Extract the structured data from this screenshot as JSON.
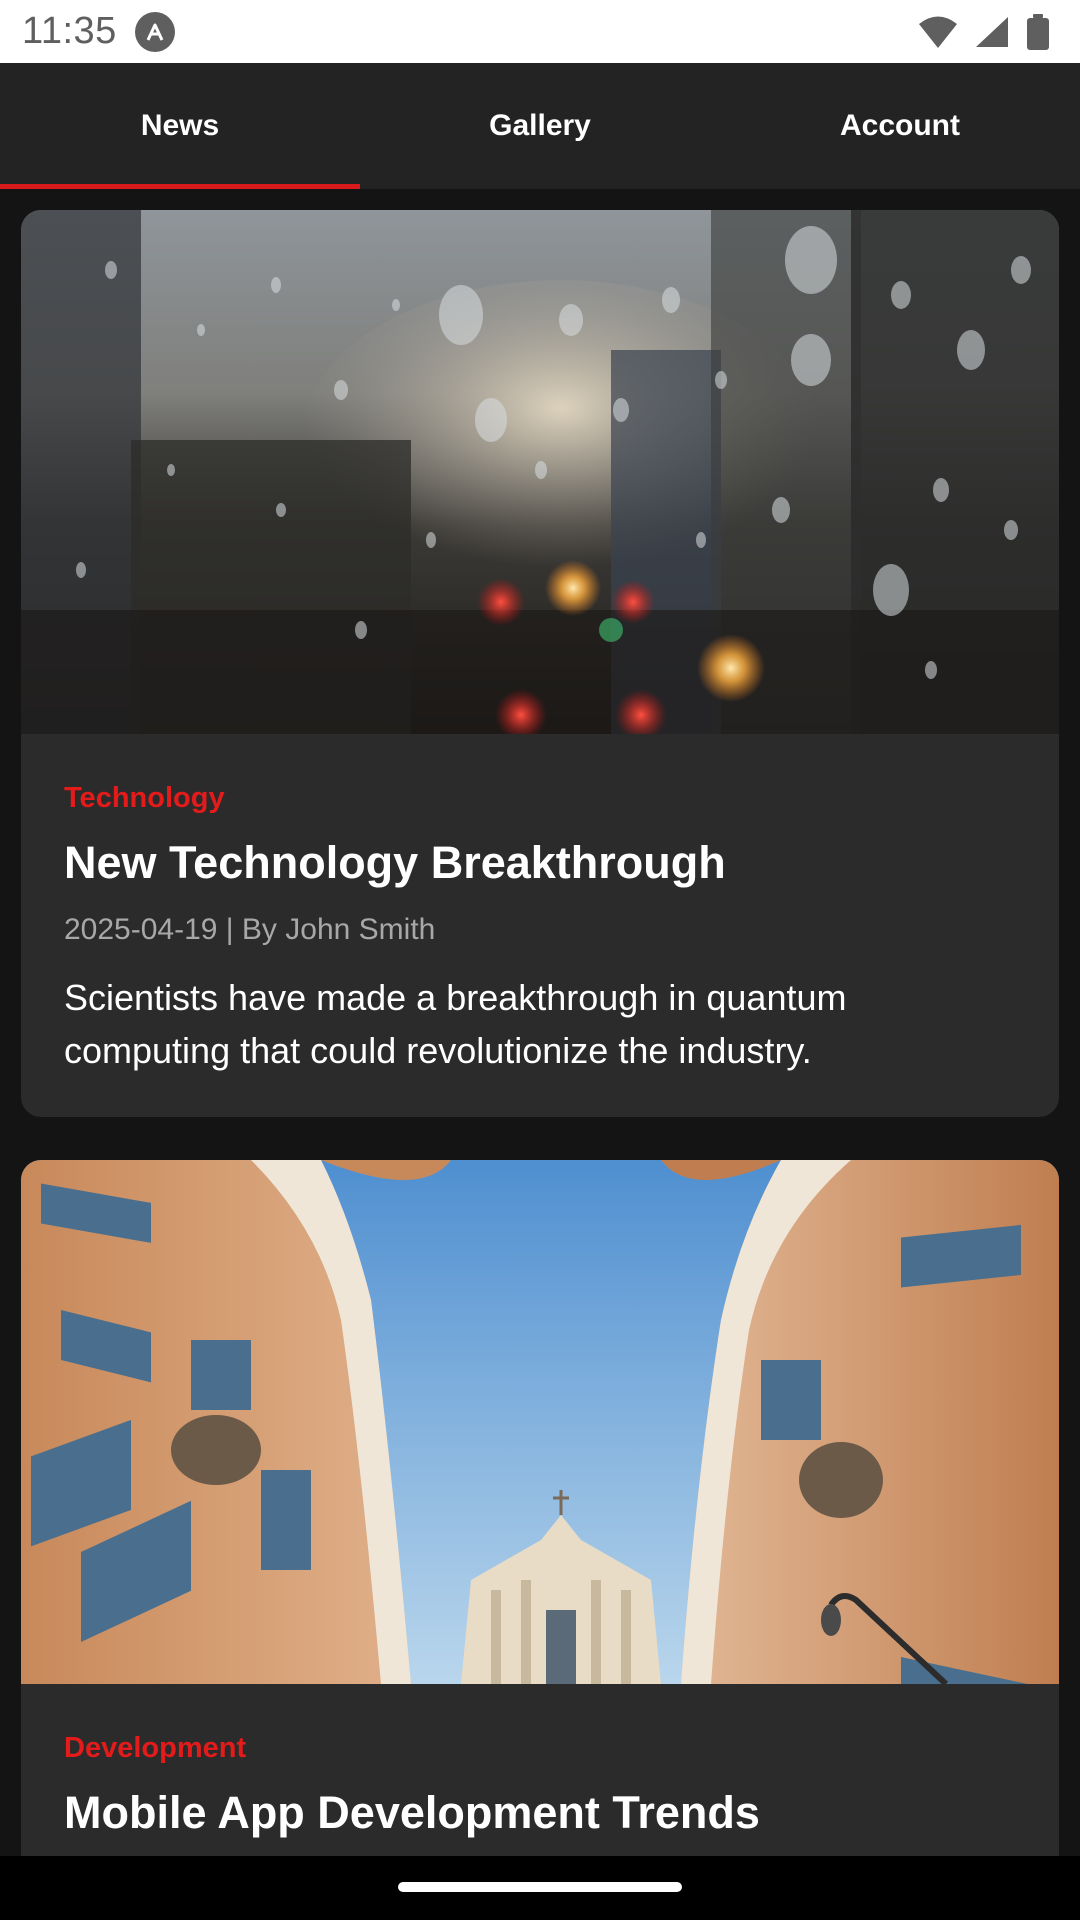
{
  "status_bar": {
    "time": "11:35",
    "icons": [
      "app-notification-icon",
      "wifi-icon",
      "cellular-signal-icon",
      "battery-icon"
    ]
  },
  "tabs": [
    {
      "label": "News",
      "active": true
    },
    {
      "label": "Gallery",
      "active": false
    },
    {
      "label": "Account",
      "active": false
    }
  ],
  "colors": {
    "accent": "#d91a1a",
    "category": "#e31b1b",
    "tab_bar": "#232323",
    "card": "#2b2b2b",
    "background": "#141414"
  },
  "articles": [
    {
      "image": "rainy-window-city-photo",
      "category": "Technology",
      "title": "New Technology Breakthrough",
      "meta": "2025-04-19 | By John Smith",
      "summary": "Scientists have made a breakthrough in quantum computing that could revolutionize the industry."
    },
    {
      "image": "rome-buildings-sky-photo",
      "category": "Development",
      "title": "Mobile App Development Trends"
    }
  ]
}
